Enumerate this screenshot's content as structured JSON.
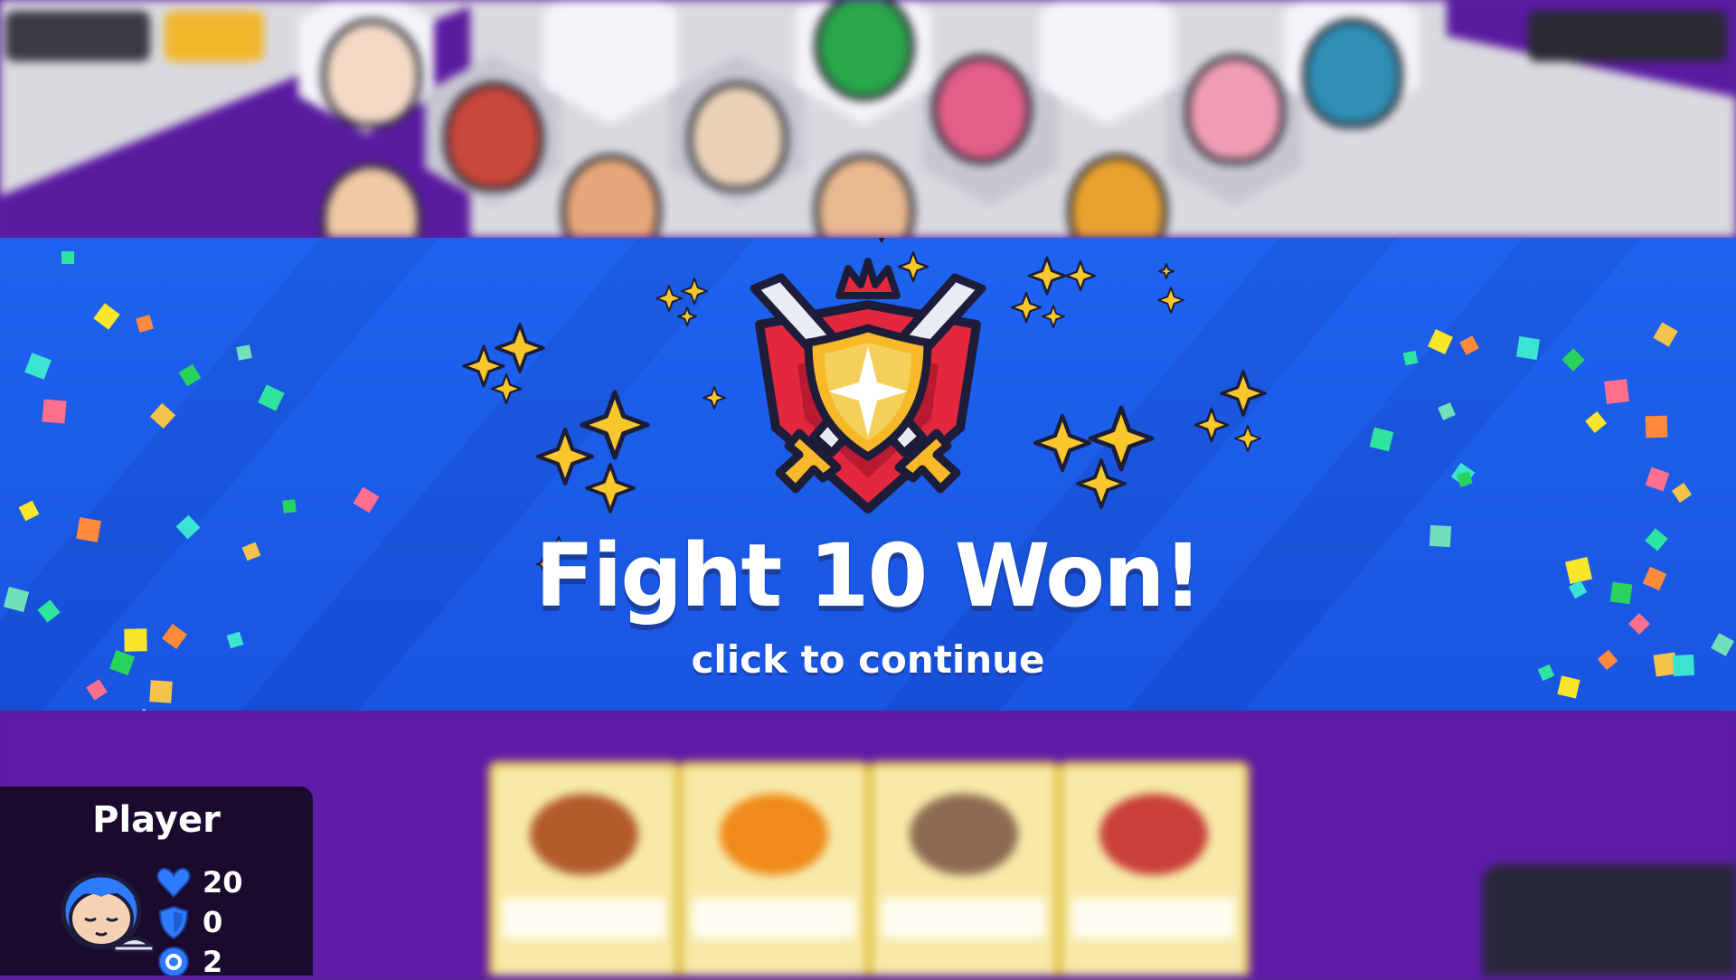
{
  "banner": {
    "title": "Fight 10 Won!",
    "subtitle": "click to continue",
    "color": "#1e63ef"
  },
  "player": {
    "name": "Player",
    "avatar_icon": "sleeping-chef-icon",
    "stats": [
      {
        "icon": "heart-icon",
        "value": "20",
        "color": "#2f7bff"
      },
      {
        "icon": "shield-icon",
        "value": "0",
        "color": "#2f7bff"
      },
      {
        "icon": "coin-icon",
        "value": "2",
        "color": "#2f7bff"
      }
    ]
  },
  "emblem_icon": "crossed-swords-shield-crown-icon"
}
